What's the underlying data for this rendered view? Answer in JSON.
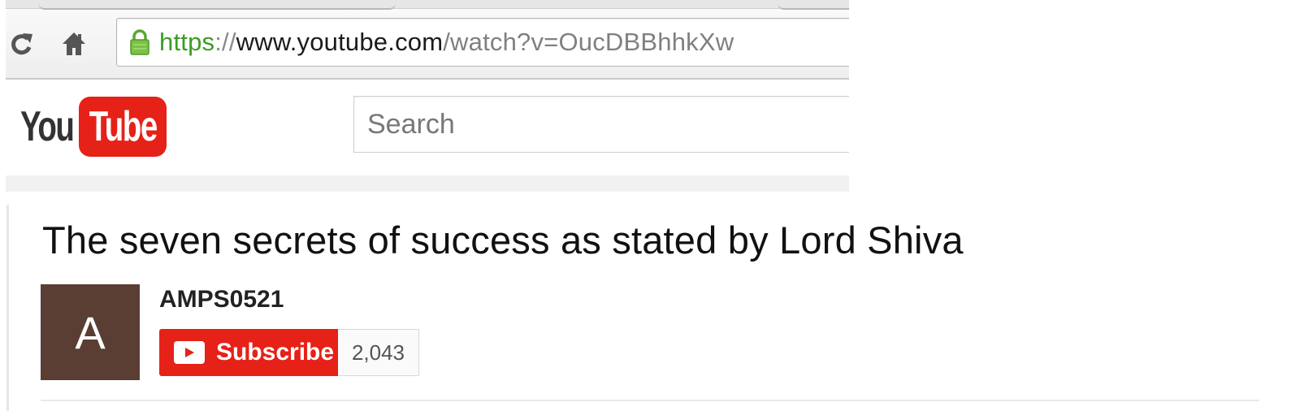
{
  "browser": {
    "url_scheme": "https",
    "url_separator": "://",
    "url_host": "www.youtube.com",
    "url_path": "/watch?v=OucDBBhhkXw",
    "icons": [
      "reload-icon",
      "home-icon",
      "lock-icon"
    ]
  },
  "masthead": {
    "logo_you": "You",
    "logo_tube": "Tube",
    "search_placeholder": "Search"
  },
  "video": {
    "title": "The seven secrets of success as stated by Lord Shiva",
    "channel": {
      "avatar_letter": "A",
      "name": "AMPS0521"
    },
    "subscribe_label": "Subscribe",
    "subscriber_count": "2,043"
  },
  "colors": {
    "brand_red": "#e62117",
    "avatar_bg": "#5a3d33",
    "secure_green": "#3a9d23"
  }
}
